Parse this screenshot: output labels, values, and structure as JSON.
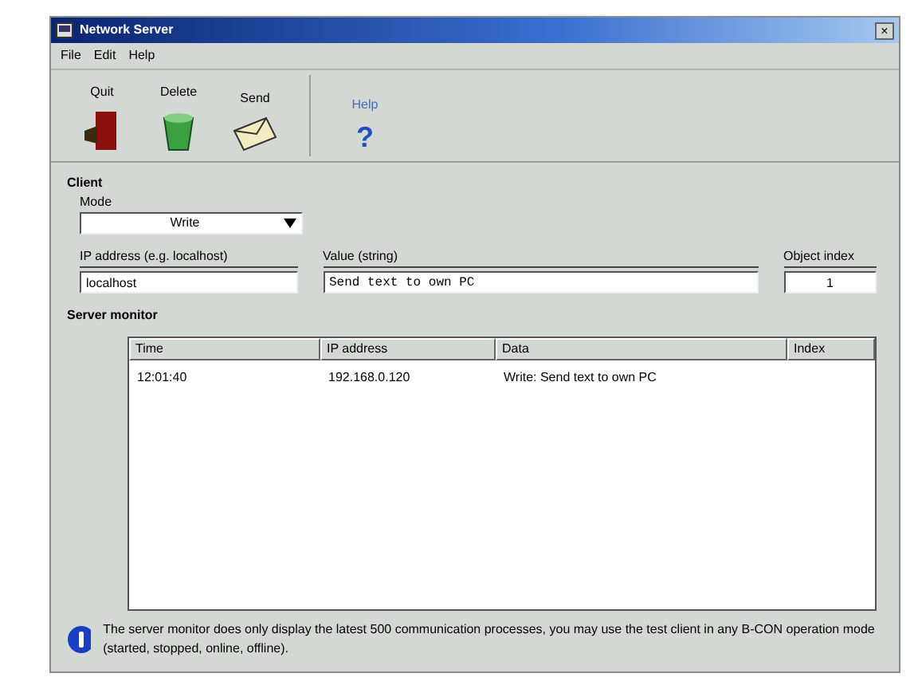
{
  "window": {
    "title": "Network Server",
    "close": "×"
  },
  "menu": [
    "File",
    "Edit",
    "Help"
  ],
  "toolbar": [
    {
      "label": "Quit",
      "kind": "quit"
    },
    {
      "label": "Delete",
      "kind": "delete"
    },
    {
      "label": "Send",
      "kind": "send"
    },
    {
      "label": "Help",
      "kind": "help",
      "glyph": "?"
    }
  ],
  "client": {
    "title": "Client",
    "mode_label": "Mode",
    "mode_value": "Write",
    "ip_label": "IP address (e.g. localhost)",
    "ip_value": "localhost",
    "value_label": "Value (string)",
    "value_value": "Send text to own PC",
    "index_label": "Object index",
    "index_value": "1"
  },
  "monitor": {
    "title": "Server monitor",
    "columns": [
      "Time",
      "IP address",
      "Data",
      "Index"
    ],
    "rows": [
      [
        "12:01:40",
        "192.168.0.120",
        "Write: Send text to own PC",
        ""
      ]
    ]
  },
  "info": "The server monitor does only display the latest 500 communication processes, you may use the test client in any B-CON operation mode (started, stopped, online, offline)."
}
